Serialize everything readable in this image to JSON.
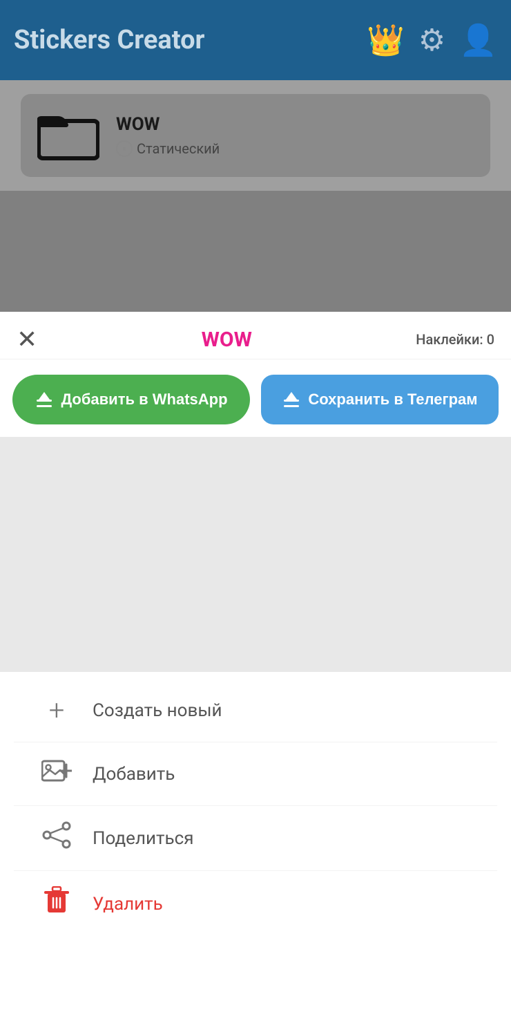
{
  "header": {
    "title": "Stickers Creator",
    "icons": {
      "crown": "👑",
      "gear": "⚙",
      "person": "👤"
    }
  },
  "pack": {
    "name": "WOW",
    "type": "Статический",
    "type_icon": "⏸"
  },
  "action_bar": {
    "close_label": "✕",
    "pack_title": "WOW",
    "sticker_count_label": "Наклейки: 0"
  },
  "buttons": {
    "whatsapp_label": "Добавить в WhatsApp",
    "telegram_label": "Сохранить в Телеграм",
    "upload_icon": "⬆"
  },
  "menu": {
    "items": [
      {
        "id": "create-new",
        "icon": "+",
        "label": "Создать новый",
        "delete": false
      },
      {
        "id": "add",
        "icon": "🖼",
        "label": "Добавить",
        "delete": false
      },
      {
        "id": "share",
        "icon": "⟨",
        "label": "Поделиться",
        "delete": false
      },
      {
        "id": "delete",
        "icon": "🗑",
        "label": "Удалить",
        "delete": true
      }
    ]
  }
}
